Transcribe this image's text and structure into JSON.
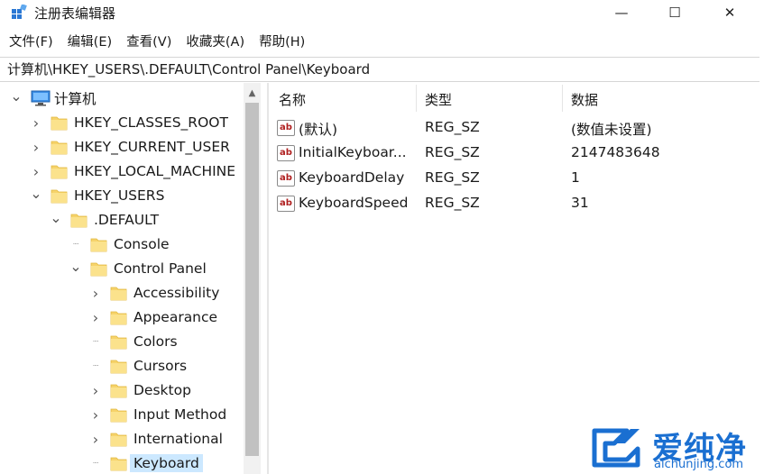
{
  "window": {
    "title": "注册表编辑器",
    "min_glyph": "—",
    "max_glyph": "☐",
    "close_glyph": "✕"
  },
  "menu": [
    "文件(F)",
    "编辑(E)",
    "查看(V)",
    "收藏夹(A)",
    "帮助(H)"
  ],
  "address": "计算机\\HKEY_USERS\\.DEFAULT\\Control Panel\\Keyboard",
  "tree": [
    {
      "label": "计算机",
      "depth": 0,
      "expander": "open",
      "icon": "computer-icon"
    },
    {
      "label": "HKEY_CLASSES_ROOT",
      "depth": 1,
      "expander": "closed",
      "icon": "folder-icon"
    },
    {
      "label": "HKEY_CURRENT_USER",
      "depth": 1,
      "expander": "closed",
      "icon": "folder-icon"
    },
    {
      "label": "HKEY_LOCAL_MACHINE",
      "depth": 1,
      "expander": "closed",
      "icon": "folder-icon"
    },
    {
      "label": "HKEY_USERS",
      "depth": 1,
      "expander": "open",
      "icon": "folder-icon"
    },
    {
      "label": ".DEFAULT",
      "depth": 2,
      "expander": "open",
      "icon": "folder-icon"
    },
    {
      "label": "Console",
      "depth": 3,
      "expander": "none",
      "icon": "folder-icon"
    },
    {
      "label": "Control Panel",
      "depth": 3,
      "expander": "open",
      "icon": "folder-icon"
    },
    {
      "label": "Accessibility",
      "depth": 4,
      "expander": "closed",
      "icon": "folder-icon"
    },
    {
      "label": "Appearance",
      "depth": 4,
      "expander": "closed",
      "icon": "folder-icon"
    },
    {
      "label": "Colors",
      "depth": 4,
      "expander": "none",
      "icon": "folder-icon"
    },
    {
      "label": "Cursors",
      "depth": 4,
      "expander": "none",
      "icon": "folder-icon"
    },
    {
      "label": "Desktop",
      "depth": 4,
      "expander": "closed",
      "icon": "folder-icon"
    },
    {
      "label": "Input Method",
      "depth": 4,
      "expander": "closed",
      "icon": "folder-icon"
    },
    {
      "label": "International",
      "depth": 4,
      "expander": "closed",
      "icon": "folder-icon"
    },
    {
      "label": "Keyboard",
      "depth": 4,
      "expander": "none",
      "icon": "folder-icon",
      "selected": true
    }
  ],
  "list": {
    "headers": {
      "name": "名称",
      "type": "类型",
      "data": "数据"
    },
    "rows": [
      {
        "name": "(默认)",
        "type": "REG_SZ",
        "data": "(数值未设置)"
      },
      {
        "name": "InitialKeyboar...",
        "type": "REG_SZ",
        "data": "2147483648"
      },
      {
        "name": "KeyboardDelay",
        "type": "REG_SZ",
        "data": "1"
      },
      {
        "name": "KeyboardSpeed",
        "type": "REG_SZ",
        "data": "31"
      }
    ],
    "value_icon_text": "ab"
  },
  "watermark": {
    "text": "爱纯净",
    "sub": "aichunjing.com"
  },
  "colors": {
    "selection": "#cce8ff",
    "folder": "#f6d36b",
    "accent": "#1a6fd1"
  }
}
